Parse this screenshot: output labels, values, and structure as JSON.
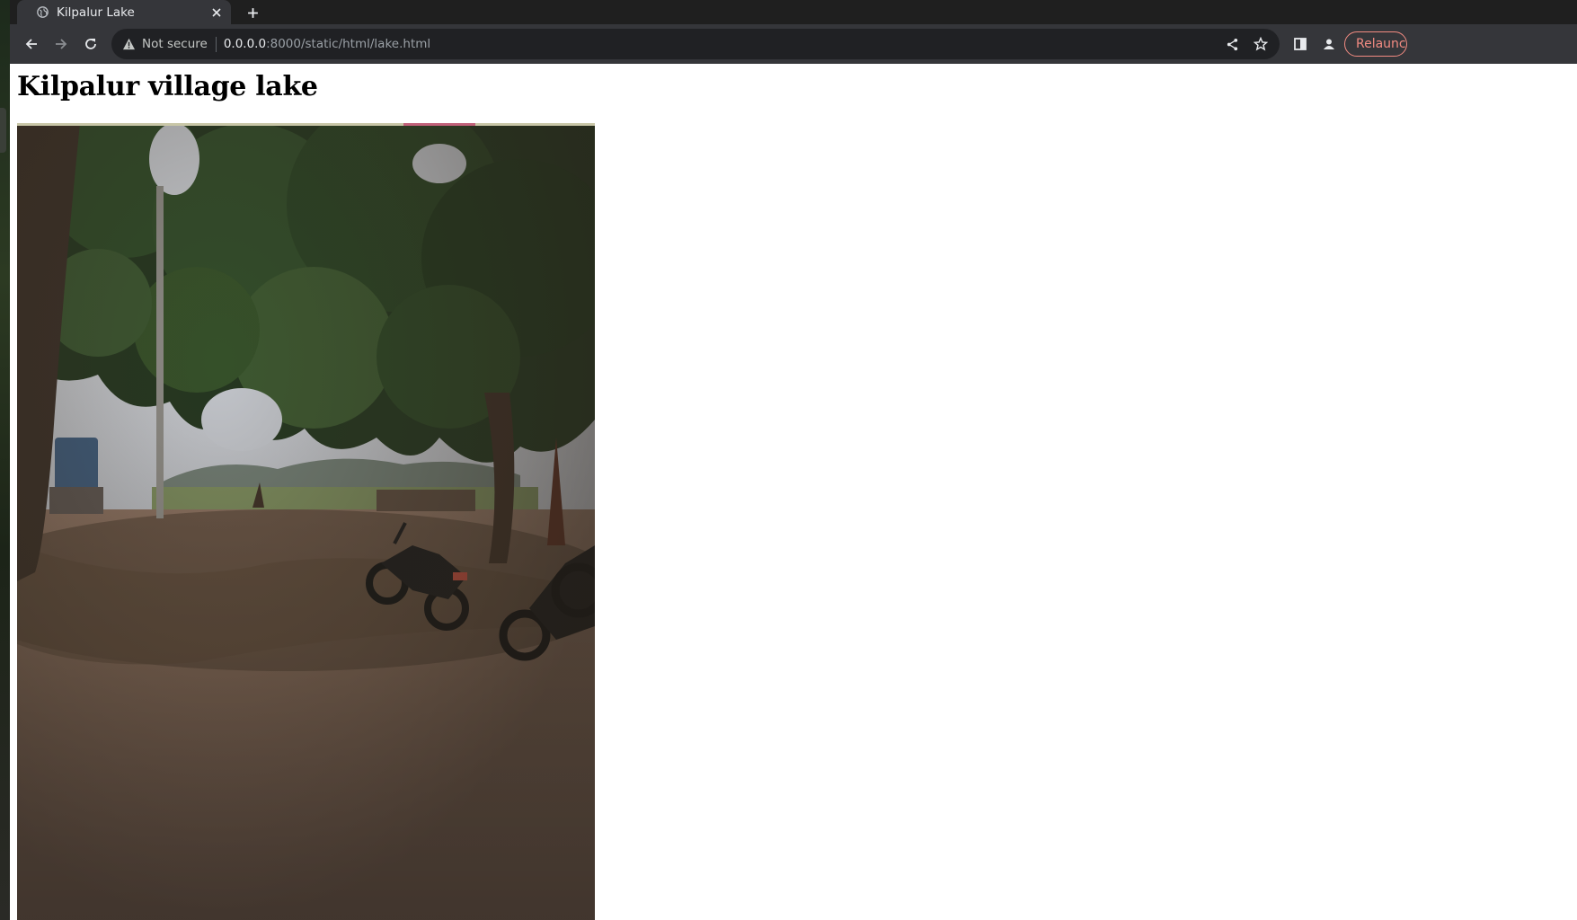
{
  "tab": {
    "title": "Kilpalur Lake"
  },
  "address_bar": {
    "security_label": "Not secure",
    "url_host": "0.0.0.0",
    "url_rest": ":8000/static/html/lake.html"
  },
  "toolbar": {
    "relaunch_label": "Relaunch"
  },
  "page": {
    "heading": "Kilpalur village lake",
    "image": {
      "subject": "tree-shaded dirt ground with parked motorcycles near a field"
    }
  },
  "colors": {
    "relaunch_accent": "#f28b82",
    "page_bg": "#ffffff",
    "chrome_dark": "#202124"
  }
}
